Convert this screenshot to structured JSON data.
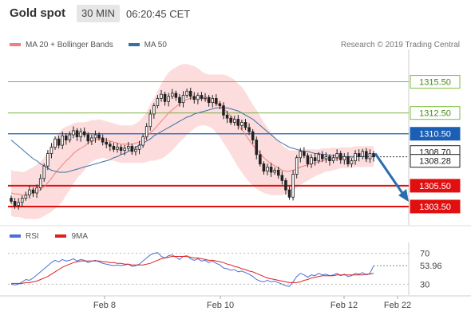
{
  "header": {
    "symbol": "Gold spot",
    "timeframe": "30 MIN",
    "time": "06:20:45 CET"
  },
  "legend": {
    "items": [
      {
        "label": "MA 20 + Bollinger Bands",
        "color": "#f08080"
      },
      {
        "label": "MA 50",
        "color": "#3a6ea5"
      }
    ],
    "credit": "Research © 2019 Trading Central"
  },
  "rsi_legend": {
    "items": [
      {
        "label": "RSI",
        "color": "#4a6fd8"
      },
      {
        "label": "9MA",
        "color": "#e02020"
      }
    ]
  },
  "chart_data": [
    {
      "type": "candlestick",
      "title": "Gold spot",
      "x_tick_labels": [
        "Feb 8",
        "Feb 10",
        "Feb 12",
        "Feb 22"
      ],
      "ylim": [
        1302.5,
        1318.0
      ],
      "current_price": "1308.28",
      "price_tag_obscured": "1308.70",
      "levels": [
        {
          "label": "1315.50",
          "value": 1315.5,
          "color": "#6aaa2a",
          "role": "resistance"
        },
        {
          "label": "1312.50",
          "value": 1312.5,
          "color": "#6aaa2a",
          "role": "resistance"
        },
        {
          "label": "1310.50",
          "value": 1310.5,
          "color": "#1a5fb4",
          "role": "pivot"
        },
        {
          "label": "1305.50",
          "value": 1305.5,
          "color": "#e01010",
          "role": "support"
        },
        {
          "label": "1303.50",
          "value": 1303.5,
          "color": "#e01010",
          "role": "support"
        }
      ],
      "closes": [
        1304.0,
        1303.6,
        1303.9,
        1304.3,
        1304.6,
        1305.1,
        1304.8,
        1305.3,
        1306.2,
        1307.4,
        1308.6,
        1309.2,
        1310.0,
        1309.4,
        1310.3,
        1309.9,
        1310.4,
        1310.8,
        1310.2,
        1310.7,
        1310.4,
        1309.8,
        1310.1,
        1310.4,
        1310.1,
        1309.7,
        1309.5,
        1309.3,
        1309.0,
        1309.2,
        1308.9,
        1309.1,
        1309.3,
        1308.8,
        1309.0,
        1309.4,
        1310.2,
        1311.2,
        1312.4,
        1313.2,
        1313.9,
        1314.3,
        1313.6,
        1314.1,
        1314.4,
        1314.0,
        1313.5,
        1314.2,
        1314.6,
        1314.1,
        1313.8,
        1314.2,
        1313.9,
        1314.0,
        1313.5,
        1313.9,
        1313.4,
        1313.2,
        1312.3,
        1312.0,
        1311.6,
        1311.9,
        1311.3,
        1311.6,
        1311.1,
        1310.7,
        1309.9,
        1308.5,
        1307.6,
        1306.9,
        1307.3,
        1306.8,
        1307.0,
        1306.5,
        1306.0,
        1305.1,
        1304.4,
        1306.6,
        1308.2,
        1308.8,
        1308.4,
        1307.6,
        1308.2,
        1307.9,
        1308.5,
        1308.1,
        1308.3,
        1307.9,
        1308.2,
        1308.6,
        1308.0,
        1308.3,
        1307.6,
        1307.9,
        1308.6,
        1308.3,
        1308.8,
        1308.1,
        1308.6,
        1308.28
      ],
      "ma20": [
        1304.8,
        1304.7,
        1304.7,
        1304.6,
        1304.6,
        1304.7,
        1304.8,
        1304.9,
        1305.1,
        1305.4,
        1305.8,
        1306.2,
        1306.7,
        1307.1,
        1307.5,
        1307.9,
        1308.2,
        1308.6,
        1308.9,
        1309.1,
        1309.3,
        1309.6,
        1309.8,
        1309.9,
        1310.0,
        1310.0,
        1309.9,
        1309.8,
        1309.7,
        1309.6,
        1309.5,
        1309.5,
        1309.5,
        1309.5,
        1309.6,
        1309.7,
        1309.9,
        1310.2,
        1310.6,
        1310.9,
        1311.3,
        1311.7,
        1312.1,
        1312.5,
        1312.8,
        1313.1,
        1313.4,
        1313.6,
        1313.8,
        1313.9,
        1314.0,
        1314.0,
        1313.9,
        1313.8,
        1313.7,
        1313.6,
        1313.4,
        1313.2,
        1312.9,
        1312.6,
        1312.2,
        1311.8,
        1311.3,
        1310.9,
        1310.4,
        1309.9,
        1309.4,
        1309.0,
        1308.6,
        1308.2,
        1307.9,
        1307.6,
        1307.4,
        1307.2,
        1307.0,
        1306.9,
        1306.9,
        1307.0,
        1307.1,
        1307.3,
        1307.4,
        1307.5,
        1307.6,
        1307.7,
        1307.8,
        1307.9,
        1308.0,
        1308.0,
        1308.1,
        1308.1,
        1308.2,
        1308.2,
        1308.2,
        1308.2,
        1308.3,
        1308.3,
        1308.3,
        1308.3,
        1308.3,
        1308.3
      ],
      "ma50": [
        1309.9,
        1309.6,
        1309.3,
        1309.0,
        1308.7,
        1308.4,
        1308.1,
        1307.9,
        1307.6,
        1307.4,
        1307.2,
        1307.0,
        1306.9,
        1306.8,
        1306.8,
        1306.8,
        1306.9,
        1307.0,
        1307.1,
        1307.2,
        1307.3,
        1307.4,
        1307.5,
        1307.6,
        1307.7,
        1307.8,
        1307.9,
        1308.0,
        1308.2,
        1308.3,
        1308.5,
        1308.6,
        1308.8,
        1309.0,
        1309.2,
        1309.4,
        1309.6,
        1309.8,
        1310.0,
        1310.3,
        1310.5,
        1310.7,
        1310.9,
        1311.1,
        1311.3,
        1311.5,
        1311.7,
        1311.9,
        1312.1,
        1312.2,
        1312.4,
        1312.5,
        1312.6,
        1312.7,
        1312.8,
        1312.9,
        1313.0,
        1313.0,
        1313.0,
        1313.0,
        1312.9,
        1312.8,
        1312.7,
        1312.5,
        1312.3,
        1312.1,
        1311.9,
        1311.6,
        1311.3,
        1311.0,
        1310.7,
        1310.4,
        1310.1,
        1309.8,
        1309.6,
        1309.4,
        1309.2,
        1309.1,
        1309.0,
        1308.9,
        1308.8,
        1308.8,
        1308.7,
        1308.6,
        1308.6,
        1308.5,
        1308.5,
        1308.4,
        1308.4,
        1308.4,
        1308.3,
        1308.3,
        1308.3,
        1308.3,
        1308.3,
        1308.3,
        1308.3,
        1308.3,
        1308.3,
        1308.3
      ],
      "bb_width": [
        2.2,
        2.2,
        2.2,
        2.2,
        2.3,
        2.4,
        2.5,
        2.6,
        2.7,
        2.8,
        3.0,
        3.2,
        3.4,
        3.5,
        3.5,
        3.3,
        3.1,
        2.9,
        2.7,
        2.5,
        2.3,
        2.1,
        2.0,
        1.9,
        1.9,
        1.8,
        1.8,
        1.8,
        1.8,
        1.8,
        1.8,
        1.8,
        1.8,
        1.8,
        1.9,
        2.0,
        2.2,
        2.4,
        2.7,
        3.0,
        3.3,
        3.6,
        3.8,
        3.9,
        3.9,
        3.8,
        3.7,
        3.6,
        3.4,
        3.2,
        3.0,
        2.8,
        2.6,
        2.5,
        2.5,
        2.6,
        2.8,
        3.0,
        3.3,
        3.5,
        3.7,
        3.9,
        4.0,
        4.1,
        4.1,
        4.0,
        3.9,
        3.8,
        3.6,
        3.4,
        3.2,
        3.0,
        2.8,
        2.6,
        2.4,
        2.2,
        2.0,
        1.9,
        1.8,
        1.7,
        1.6,
        1.5,
        1.4,
        1.3,
        1.2,
        1.2,
        1.1,
        1.1,
        1.1,
        1.0,
        1.0,
        1.0,
        1.0,
        1.0,
        1.0,
        1.0,
        1.0,
        1.0,
        1.0,
        1.0
      ],
      "forecast": {
        "from": 1308.6,
        "to": 1303.5
      }
    },
    {
      "type": "line",
      "title": "RSI",
      "ylim": [
        20,
        80
      ],
      "levels": [
        {
          "label": "70",
          "value": 70
        },
        {
          "label": "30",
          "value": 30
        }
      ],
      "current_value": "53.96",
      "series": [
        {
          "name": "RSI",
          "color": "#4a6fd8",
          "values": [
            30,
            29,
            30,
            33,
            36,
            35,
            38,
            42,
            46,
            50,
            54,
            58,
            61,
            59,
            62,
            60,
            61,
            63,
            60,
            62,
            61,
            58,
            60,
            61,
            59,
            57,
            56,
            55,
            54,
            55,
            54,
            55,
            56,
            53,
            54,
            56,
            60,
            64,
            68,
            70,
            71,
            66,
            64,
            67,
            68,
            65,
            62,
            66,
            67,
            63,
            61,
            63,
            60,
            61,
            58,
            60,
            57,
            55,
            51,
            50,
            48,
            49,
            46,
            47,
            45,
            43,
            40,
            36,
            34,
            33,
            35,
            33,
            34,
            32,
            30,
            28,
            27,
            33,
            40,
            44,
            42,
            39,
            42,
            41,
            44,
            42,
            43,
            41,
            42,
            44,
            41,
            43,
            40,
            41,
            44,
            43,
            45,
            42,
            44,
            53.96
          ]
        },
        {
          "name": "9MA",
          "color": "#e02020",
          "values": [
            31,
            31,
            31,
            31,
            32,
            32,
            33,
            34,
            36,
            38,
            40,
            43,
            46,
            49,
            52,
            54,
            56,
            58,
            59,
            60,
            60,
            60,
            60,
            60,
            60,
            59,
            59,
            58,
            58,
            57,
            57,
            56,
            56,
            55,
            55,
            55,
            55,
            56,
            57,
            59,
            61,
            63,
            64,
            65,
            66,
            66,
            66,
            66,
            66,
            65,
            64,
            64,
            63,
            62,
            61,
            61,
            60,
            59,
            58,
            56,
            55,
            53,
            52,
            50,
            49,
            47,
            46,
            44,
            42,
            40,
            38,
            37,
            36,
            35,
            34,
            33,
            32,
            32,
            32,
            33,
            35,
            36,
            38,
            39,
            40,
            41,
            41,
            41,
            41,
            42,
            42,
            42,
            42,
            42,
            42,
            42,
            42,
            43,
            43,
            44
          ]
        }
      ]
    }
  ]
}
